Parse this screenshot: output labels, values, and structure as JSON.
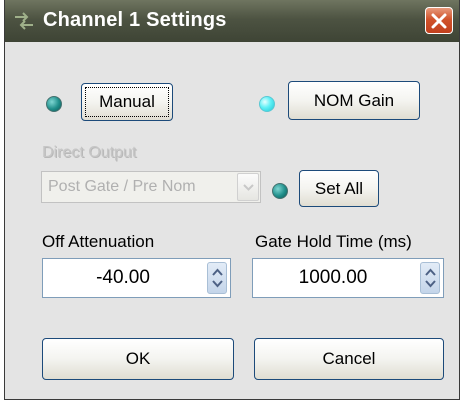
{
  "window": {
    "title": "Channel 1 Settings"
  },
  "mode": {
    "manual_label": "Manual",
    "nom_gain_label": "NOM Gain"
  },
  "direct_output": {
    "label": "Direct Output",
    "selected_value": "Post Gate / Pre Nom",
    "set_all_label": "Set All"
  },
  "off_attenuation": {
    "label": "Off Attenuation",
    "value": "-40.00"
  },
  "gate_hold_time": {
    "label": "Gate Hold Time (ms)",
    "value": "1000.00"
  },
  "footer": {
    "ok_label": "OK",
    "cancel_label": "Cancel"
  }
}
